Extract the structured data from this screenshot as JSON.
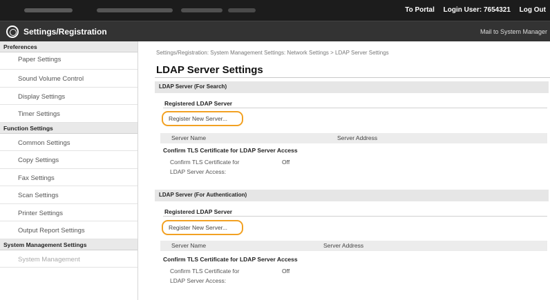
{
  "topbar": {
    "portal_link": "To Portal",
    "login_user": "Login User: 7654321",
    "logout_link": "Log Out"
  },
  "header": {
    "icon": "settings-gear-icon",
    "title": "Settings/Registration",
    "mail_link": "Mail to System Manager"
  },
  "sidebar": {
    "sections": [
      {
        "heading": "Preferences",
        "items": [
          "Paper Settings",
          "Sound Volume Control",
          "Display Settings",
          "Timer Settings"
        ]
      },
      {
        "heading": "Function Settings",
        "items": [
          "Common Settings",
          "Copy Settings",
          "Fax Settings",
          "Scan Settings",
          "Printer Settings",
          "Output Report Settings"
        ]
      },
      {
        "heading": "System Management Settings",
        "items": [
          "System Management"
        ]
      }
    ]
  },
  "main": {
    "breadcrumb": "Settings/Registration: System Management Settings: Network Settings > LDAP Server Settings",
    "page_title": "LDAP Server Settings",
    "search_section": {
      "title": "LDAP Server (For Search)",
      "registered_heading": "Registered LDAP Server",
      "register_button": "Register New Server...",
      "col_name": "Server Name",
      "col_address": "Server Address",
      "confirm_heading": "Confirm TLS Certificate for LDAP Server Access",
      "confirm_label": "Confirm TLS Certificate for LDAP Server Access:",
      "confirm_value": "Off"
    },
    "auth_section": {
      "title": "LDAP Server (For Authentication)",
      "registered_heading": "Registered LDAP Server",
      "register_button": "Register New Server...",
      "col_name": "Server Name",
      "col_address": "Server Address",
      "confirm_heading": "Confirm TLS Certificate for LDAP Server Access",
      "confirm_label": "Confirm TLS Certificate for LDAP Server Access:",
      "confirm_value": "Off"
    }
  },
  "colors": {
    "topbar": "#1c1c1c",
    "header": "#333333",
    "section_bar": "#e6e6e6",
    "highlight": "#f2a122"
  }
}
